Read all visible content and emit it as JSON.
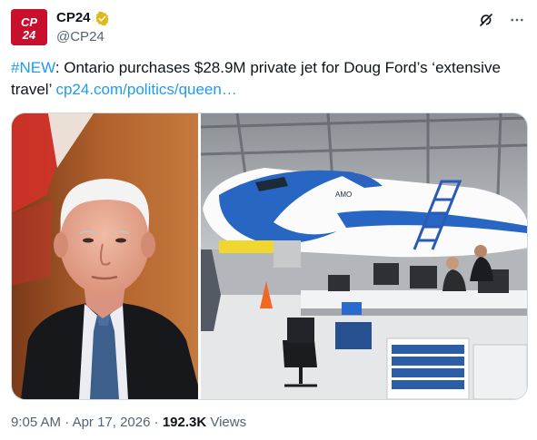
{
  "account": {
    "display_name": "CP24",
    "handle": "@CP24",
    "avatar_text": "CP24",
    "brand_color": "#c8102e",
    "verified_color": "#e2b719"
  },
  "tweet": {
    "hashtag": "#NEW",
    "body": ": Ontario purchases $28.9M private jet for Doug Ford’s ‘extensive travel’ ",
    "link_text": "cp24.com/politics/queen…",
    "link_color": "#1d9bf0"
  },
  "meta": {
    "time": "9:05 AM",
    "separator1": " · ",
    "date": "Apr 17, 2026",
    "separator2": " · ",
    "views_count": "192.3K",
    "views_label": " Views"
  },
  "media": {
    "left_photo": "portrait-photo",
    "right_photo": "aircraft-hangar-photo",
    "aircraft_nose_text": "AMO"
  },
  "icons": {
    "grok": "grok-icon",
    "more": "more-icon",
    "verified": "verified-badge-icon"
  }
}
